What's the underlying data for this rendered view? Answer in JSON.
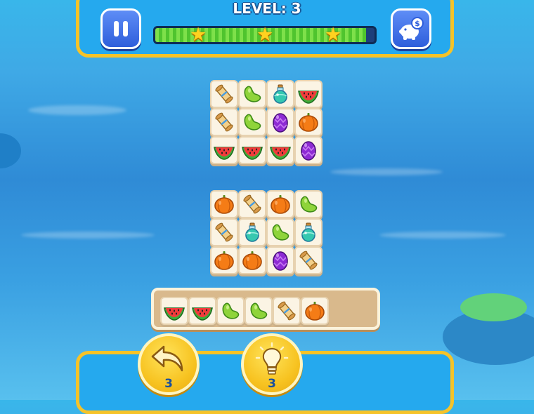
{
  "hud": {
    "level_text": "LEVEL: 3",
    "progress_fraction": 0.96,
    "stars_earned": 3,
    "pause_icon": "pause-icon",
    "shop_icon": "piggy-bank-icon"
  },
  "board_top": {
    "rows": [
      [
        "scroll",
        "bean",
        "potion",
        "watermelon"
      ],
      [
        "scroll",
        "bean",
        "egg",
        "pumpkin"
      ],
      [
        "watermelon",
        "watermelon",
        "watermelon",
        "egg"
      ]
    ]
  },
  "board_bottom": {
    "rows": [
      [
        "pumpkin",
        "scroll",
        "pumpkin",
        "bean"
      ],
      [
        "scroll",
        "potion",
        "bean",
        "potion"
      ],
      [
        "pumpkin",
        "pumpkin",
        "egg",
        "scroll"
      ]
    ]
  },
  "tray": {
    "capacity": 7,
    "items": [
      "watermelon",
      "watermelon",
      "bean",
      "bean",
      "scroll",
      "pumpkin"
    ]
  },
  "powerups": {
    "undo": {
      "icon": "undo-arrow-icon",
      "count": "3"
    },
    "hint": {
      "icon": "lightbulb-icon",
      "count": "3"
    }
  },
  "colors": {
    "panel_border": "#f6c328",
    "panel_bg": "#25a9ee",
    "progress_green": "#7ee04a",
    "tile_bg": "#fbf4e4"
  }
}
